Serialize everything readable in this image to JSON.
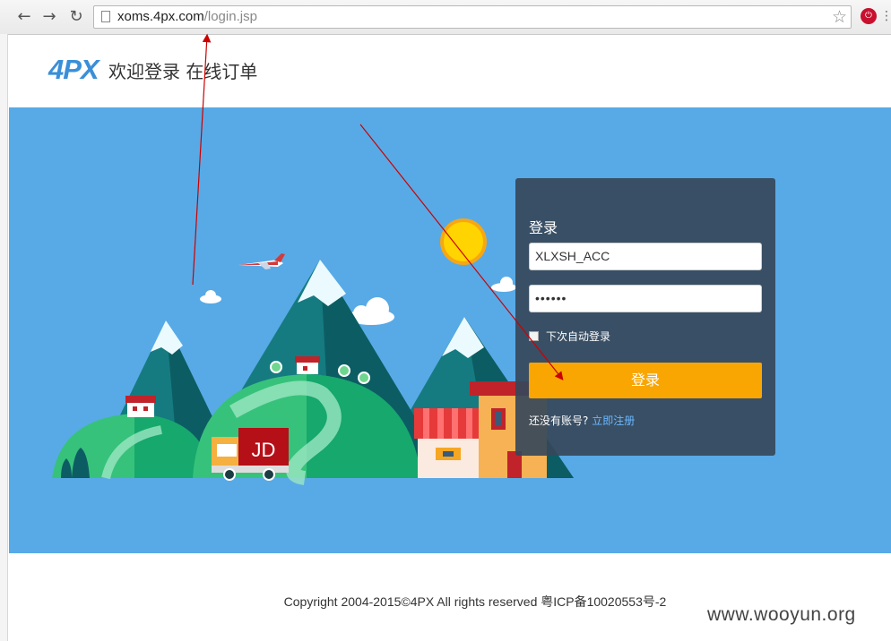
{
  "browser": {
    "back_icon": "←",
    "forward_icon": "→",
    "reload_icon": "↻",
    "url_host": "xoms.4px.com",
    "url_path": "/login.jsp",
    "star_icon": "☆",
    "menu_icon": "⋮"
  },
  "header": {
    "logo": "4PX",
    "title": "欢迎登录 在线订单"
  },
  "illustration": {
    "truck_label": "JD"
  },
  "login": {
    "title": "登录",
    "username_value": "XLXSH_ACC",
    "password_value": "••••••",
    "remember_label": "下次自动登录",
    "submit_label": "登录",
    "no_account_text": "还没有账号?",
    "register_link": "立即注册"
  },
  "footer": {
    "copyright": "Copyright 2004-2015©4PX All rights reserved 粤ICP备10020553号-2"
  },
  "watermark": "www.wooyun.org",
  "colors": {
    "hero_bg": "#58aae6",
    "submit_bg": "#f9a602",
    "panel_bg": "#36485a",
    "link": "#6ab7ff",
    "annotation": "#cc0000"
  }
}
